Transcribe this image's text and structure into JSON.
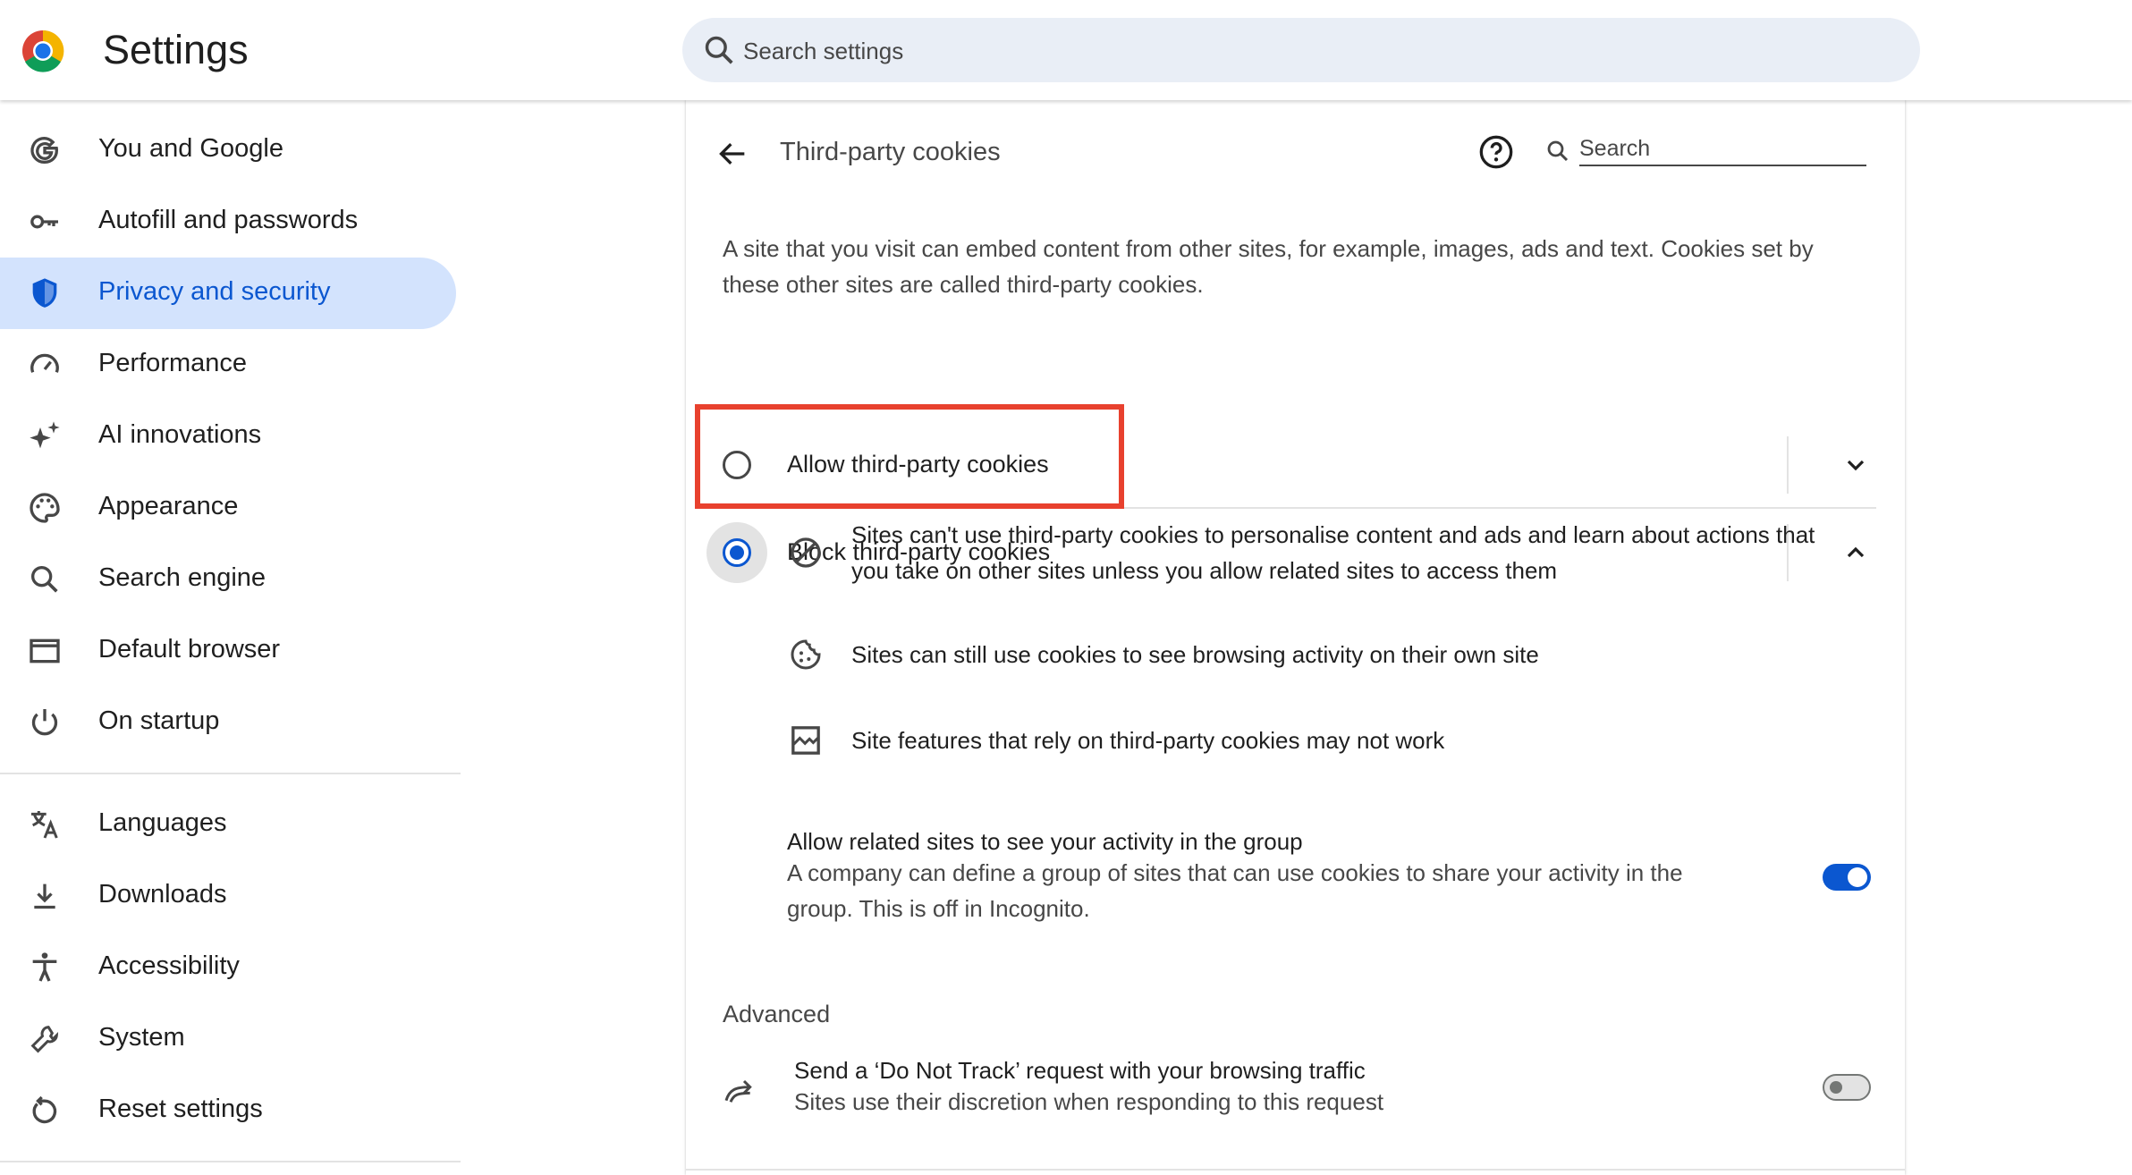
{
  "app": {
    "title": "Settings"
  },
  "search": {
    "placeholder": "Search settings"
  },
  "sidebar": {
    "items": [
      {
        "label": "You and Google",
        "icon": "google-g-icon",
        "active": false
      },
      {
        "label": "Autofill and passwords",
        "icon": "key-icon",
        "active": false
      },
      {
        "label": "Privacy and security",
        "icon": "shield-icon",
        "active": true
      },
      {
        "label": "Performance",
        "icon": "speedometer-icon",
        "active": false
      },
      {
        "label": "AI innovations",
        "icon": "sparkle-icon",
        "active": false
      },
      {
        "label": "Appearance",
        "icon": "palette-icon",
        "active": false
      },
      {
        "label": "Search engine",
        "icon": "search-icon",
        "active": false
      },
      {
        "label": "Default browser",
        "icon": "browser-window-icon",
        "active": false
      },
      {
        "label": "On startup",
        "icon": "power-icon",
        "active": false
      },
      {
        "label": "Languages",
        "icon": "translate-icon",
        "active": false
      },
      {
        "label": "Downloads",
        "icon": "download-icon",
        "active": false
      },
      {
        "label": "Accessibility",
        "icon": "accessibility-icon",
        "active": false
      },
      {
        "label": "System",
        "icon": "wrench-icon",
        "active": false
      },
      {
        "label": "Reset settings",
        "icon": "reset-icon",
        "active": false
      }
    ]
  },
  "page": {
    "title": "Third-party cookies",
    "search_placeholder": "Search",
    "description": "A site that you visit can embed content from other sites, for example, images, ads and text. Cookies set by these other sites are called third-party cookies.",
    "options": [
      {
        "label": "Allow third-party cookies",
        "selected": false
      },
      {
        "label": "Block third-party cookies",
        "selected": true
      }
    ],
    "block_details": [
      {
        "icon": "block-icon",
        "text": "Sites can't use third-party cookies to personalise content and ads and learn about actions that you take on other sites unless you allow related sites to access them"
      },
      {
        "icon": "cookie-icon",
        "text": "Sites can still use cookies to see browsing activity on their own site"
      },
      {
        "icon": "broken-image-icon",
        "text": "Site features that rely on third-party cookies may not work"
      }
    ],
    "related_sites": {
      "title": "Allow related sites to see your activity in the group",
      "subtitle": "A company can define a group of sites that can use cookies to share your activity in the group. This is off in Incognito.",
      "enabled": true
    },
    "advanced_label": "Advanced",
    "do_not_track": {
      "title": "Send a ‘Do Not Track’ request with your browsing traffic",
      "subtitle": "Sites use their discretion when responding to this request",
      "enabled": false
    }
  },
  "colors": {
    "accent": "#0b57d0",
    "active_nav_bg": "#d3e3fd",
    "highlight_box": "#e8412e"
  }
}
